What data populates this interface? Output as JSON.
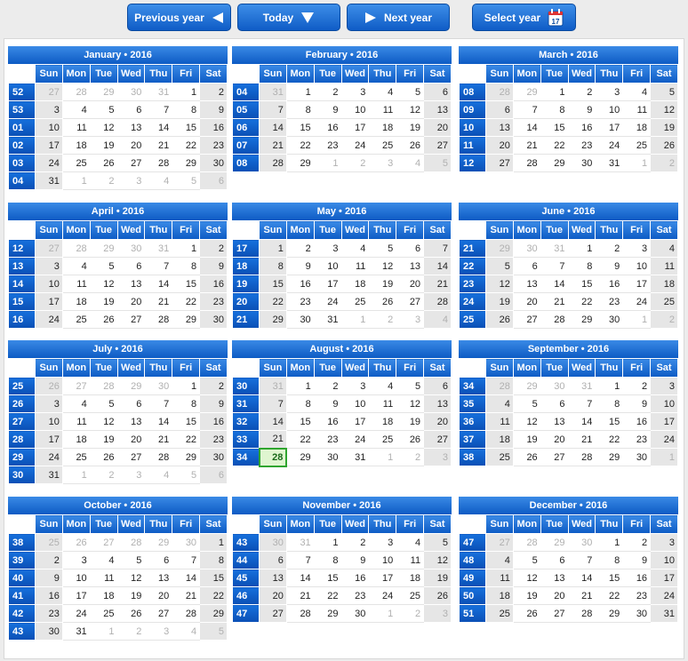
{
  "toolbar": {
    "prev_label": "Previous year",
    "today_label": "Today",
    "next_label": "Next year",
    "select_label": "Select year",
    "select_icon_text": "17"
  },
  "day_headers": [
    "Sun",
    "Mon",
    "Tue",
    "Wed",
    "Thu",
    "Fri",
    "Sat"
  ],
  "months": [
    {
      "title": "January • 2016",
      "weeks": [
        "52",
        "53",
        "01",
        "02",
        "03",
        "04"
      ],
      "days": [
        [
          "27",
          "28",
          "29",
          "30",
          "31",
          "1",
          "2"
        ],
        [
          "3",
          "4",
          "5",
          "6",
          "7",
          "8",
          "9"
        ],
        [
          "10",
          "11",
          "12",
          "13",
          "14",
          "15",
          "16"
        ],
        [
          "17",
          "18",
          "19",
          "20",
          "21",
          "22",
          "23"
        ],
        [
          "24",
          "25",
          "26",
          "27",
          "28",
          "29",
          "30"
        ],
        [
          "31",
          "1",
          "2",
          "3",
          "4",
          "5",
          "6"
        ]
      ]
    },
    {
      "title": "February • 2016",
      "weeks": [
        "04",
        "05",
        "06",
        "07",
        "08"
      ],
      "days": [
        [
          "31",
          "1",
          "2",
          "3",
          "4",
          "5",
          "6"
        ],
        [
          "7",
          "8",
          "9",
          "10",
          "11",
          "12",
          "13"
        ],
        [
          "14",
          "15",
          "16",
          "17",
          "18",
          "19",
          "20"
        ],
        [
          "21",
          "22",
          "23",
          "24",
          "25",
          "26",
          "27"
        ],
        [
          "28",
          "29",
          "1",
          "2",
          "3",
          "4",
          "5"
        ]
      ]
    },
    {
      "title": "March • 2016",
      "weeks": [
        "08",
        "09",
        "10",
        "11",
        "12"
      ],
      "days": [
        [
          "28",
          "29",
          "1",
          "2",
          "3",
          "4",
          "5"
        ],
        [
          "6",
          "7",
          "8",
          "9",
          "10",
          "11",
          "12"
        ],
        [
          "13",
          "14",
          "15",
          "16",
          "17",
          "18",
          "19"
        ],
        [
          "20",
          "21",
          "22",
          "23",
          "24",
          "25",
          "26"
        ],
        [
          "27",
          "28",
          "29",
          "30",
          "31",
          "1",
          "2"
        ]
      ]
    },
    {
      "title": "April • 2016",
      "weeks": [
        "12",
        "13",
        "14",
        "15",
        "16"
      ],
      "days": [
        [
          "27",
          "28",
          "29",
          "30",
          "31",
          "1",
          "2"
        ],
        [
          "3",
          "4",
          "5",
          "6",
          "7",
          "8",
          "9"
        ],
        [
          "10",
          "11",
          "12",
          "13",
          "14",
          "15",
          "16"
        ],
        [
          "17",
          "18",
          "19",
          "20",
          "21",
          "22",
          "23"
        ],
        [
          "24",
          "25",
          "26",
          "27",
          "28",
          "29",
          "30"
        ]
      ]
    },
    {
      "title": "May • 2016",
      "weeks": [
        "17",
        "18",
        "19",
        "20",
        "21"
      ],
      "days": [
        [
          "1",
          "2",
          "3",
          "4",
          "5",
          "6",
          "7"
        ],
        [
          "8",
          "9",
          "10",
          "11",
          "12",
          "13",
          "14"
        ],
        [
          "15",
          "16",
          "17",
          "18",
          "19",
          "20",
          "21"
        ],
        [
          "22",
          "23",
          "24",
          "25",
          "26",
          "27",
          "28"
        ],
        [
          "29",
          "30",
          "31",
          "1",
          "2",
          "3",
          "4"
        ]
      ]
    },
    {
      "title": "June • 2016",
      "weeks": [
        "21",
        "22",
        "23",
        "24",
        "25"
      ],
      "days": [
        [
          "29",
          "30",
          "31",
          "1",
          "2",
          "3",
          "4"
        ],
        [
          "5",
          "6",
          "7",
          "8",
          "9",
          "10",
          "11"
        ],
        [
          "12",
          "13",
          "14",
          "15",
          "16",
          "17",
          "18"
        ],
        [
          "19",
          "20",
          "21",
          "22",
          "23",
          "24",
          "25"
        ],
        [
          "26",
          "27",
          "28",
          "29",
          "30",
          "1",
          "2"
        ]
      ]
    },
    {
      "title": "July • 2016",
      "weeks": [
        "25",
        "26",
        "27",
        "28",
        "29",
        "30"
      ],
      "days": [
        [
          "26",
          "27",
          "28",
          "29",
          "30",
          "1",
          "2"
        ],
        [
          "3",
          "4",
          "5",
          "6",
          "7",
          "8",
          "9"
        ],
        [
          "10",
          "11",
          "12",
          "13",
          "14",
          "15",
          "16"
        ],
        [
          "17",
          "18",
          "19",
          "20",
          "21",
          "22",
          "23"
        ],
        [
          "24",
          "25",
          "26",
          "27",
          "28",
          "29",
          "30"
        ],
        [
          "31",
          "1",
          "2",
          "3",
          "4",
          "5",
          "6"
        ]
      ]
    },
    {
      "title": "August • 2016",
      "weeks": [
        "30",
        "31",
        "32",
        "33",
        "34"
      ],
      "days": [
        [
          "31",
          "1",
          "2",
          "3",
          "4",
          "5",
          "6"
        ],
        [
          "7",
          "8",
          "9",
          "10",
          "11",
          "12",
          "13"
        ],
        [
          "14",
          "15",
          "16",
          "17",
          "18",
          "19",
          "20"
        ],
        [
          "21",
          "22",
          "23",
          "24",
          "25",
          "26",
          "27"
        ],
        [
          "28",
          "29",
          "30",
          "31",
          "1",
          "2",
          "3"
        ]
      ]
    },
    {
      "title": "September • 2016",
      "weeks": [
        "34",
        "35",
        "36",
        "37",
        "38"
      ],
      "days": [
        [
          "28",
          "29",
          "30",
          "31",
          "1",
          "2",
          "3"
        ],
        [
          "4",
          "5",
          "6",
          "7",
          "8",
          "9",
          "10"
        ],
        [
          "11",
          "12",
          "13",
          "14",
          "15",
          "16",
          "17"
        ],
        [
          "18",
          "19",
          "20",
          "21",
          "22",
          "23",
          "24"
        ],
        [
          "25",
          "26",
          "27",
          "28",
          "29",
          "30",
          "1"
        ]
      ]
    },
    {
      "title": "October • 2016",
      "weeks": [
        "38",
        "39",
        "40",
        "41",
        "42",
        "43"
      ],
      "days": [
        [
          "25",
          "26",
          "27",
          "28",
          "29",
          "30",
          "1"
        ],
        [
          "2",
          "3",
          "4",
          "5",
          "6",
          "7",
          "8"
        ],
        [
          "9",
          "10",
          "11",
          "12",
          "13",
          "14",
          "15"
        ],
        [
          "16",
          "17",
          "18",
          "19",
          "20",
          "21",
          "22"
        ],
        [
          "23",
          "24",
          "25",
          "26",
          "27",
          "28",
          "29"
        ],
        [
          "30",
          "31",
          "1",
          "2",
          "3",
          "4",
          "5"
        ]
      ]
    },
    {
      "title": "November • 2016",
      "weeks": [
        "43",
        "44",
        "45",
        "46",
        "47"
      ],
      "days": [
        [
          "30",
          "31",
          "1",
          "2",
          "3",
          "4",
          "5"
        ],
        [
          "6",
          "7",
          "8",
          "9",
          "10",
          "11",
          "12"
        ],
        [
          "13",
          "14",
          "15",
          "16",
          "17",
          "18",
          "19"
        ],
        [
          "20",
          "21",
          "22",
          "23",
          "24",
          "25",
          "26"
        ],
        [
          "27",
          "28",
          "29",
          "30",
          "1",
          "2",
          "3"
        ]
      ]
    },
    {
      "title": "December • 2016",
      "weeks": [
        "47",
        "48",
        "49",
        "50",
        "51"
      ],
      "days": [
        [
          "27",
          "28",
          "29",
          "30",
          "1",
          "2",
          "3"
        ],
        [
          "4",
          "5",
          "6",
          "7",
          "8",
          "9",
          "10"
        ],
        [
          "11",
          "12",
          "13",
          "14",
          "15",
          "16",
          "17"
        ],
        [
          "18",
          "19",
          "20",
          "21",
          "22",
          "23",
          "24"
        ],
        [
          "25",
          "26",
          "27",
          "28",
          "29",
          "30",
          "31"
        ]
      ]
    }
  ],
  "today": {
    "month_index": 7,
    "day": "28"
  }
}
